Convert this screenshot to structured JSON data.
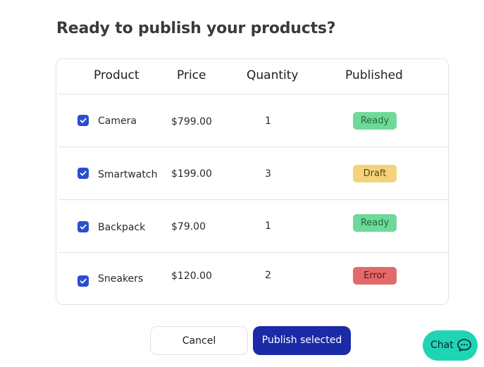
{
  "page": {
    "title": "Ready to publish your products?"
  },
  "table": {
    "columns": [
      "Product",
      "Price",
      "Quantity",
      "Published"
    ],
    "rows": [
      {
        "product": "Camera",
        "price": "$799.00",
        "quantity": "1",
        "status": "Ready",
        "checked": true
      },
      {
        "product": "Smartwatch",
        "price": "$199.00",
        "quantity": "3",
        "status": "Draft",
        "checked": true
      },
      {
        "product": "Backpack",
        "price": "$79.00",
        "quantity": "1",
        "status": "Ready",
        "checked": true
      },
      {
        "product": "Sneakers",
        "price": "$120.00",
        "quantity": "2",
        "status": "Error",
        "checked": true
      }
    ]
  },
  "actions": {
    "cancel_label": "Cancel",
    "publish_label": "Publish selected"
  },
  "chat": {
    "label": "Chat"
  },
  "colors": {
    "checkbox": "#2a4fcf",
    "status_ready_bg": "#6fd99a",
    "status_ready_text": "#1f6a3c",
    "status_draft_bg": "#f4d37c",
    "status_draft_text": "#5b4510",
    "status_error_bg": "#e36a6a",
    "status_error_text": "#5a1414",
    "publish_button": "#1b2aa6",
    "chat_button": "#1fd4b4"
  }
}
